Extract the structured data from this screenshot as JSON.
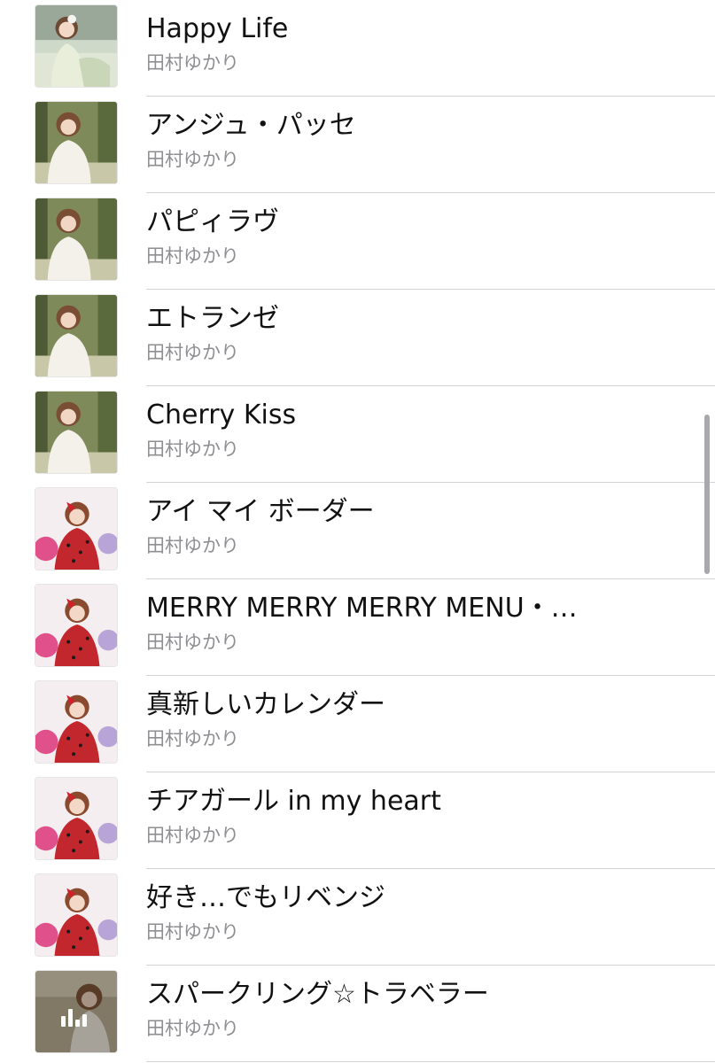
{
  "songs": [
    {
      "title": "Happy Life",
      "artist": "田村ゆかり",
      "art": "art-1"
    },
    {
      "title": "アンジュ・パッセ",
      "artist": "田村ゆかり",
      "art": "art-2"
    },
    {
      "title": "パピィラヴ",
      "artist": "田村ゆかり",
      "art": "art-2"
    },
    {
      "title": "エトランゼ",
      "artist": "田村ゆかり",
      "art": "art-2"
    },
    {
      "title": "Cherry Kiss",
      "artist": "田村ゆかり",
      "art": "art-2"
    },
    {
      "title": "アイ マイ ボーダー",
      "artist": "田村ゆかり",
      "art": "art-3"
    },
    {
      "title": "MERRY MERRY MERRY MENU・…",
      "artist": "田村ゆかり",
      "art": "art-3"
    },
    {
      "title": "真新しいカレンダー",
      "artist": "田村ゆかり",
      "art": "art-3"
    },
    {
      "title": "チアガール in my heart",
      "artist": "田村ゆかり",
      "art": "art-3"
    },
    {
      "title": "好き…でもリベンジ",
      "artist": "田村ゆかり",
      "art": "art-3"
    },
    {
      "title": "スパークリング☆トラベラー",
      "artist": "田村ゆかり",
      "art": "art-4",
      "now_playing": true
    }
  ],
  "icons": {
    "now_playing": "now-playing-bars-icon"
  },
  "colors": {
    "title": "#111111",
    "artist": "#8e8e93",
    "separator": "#d1d1d6",
    "scroll_indicator": "#a9a9ad"
  }
}
